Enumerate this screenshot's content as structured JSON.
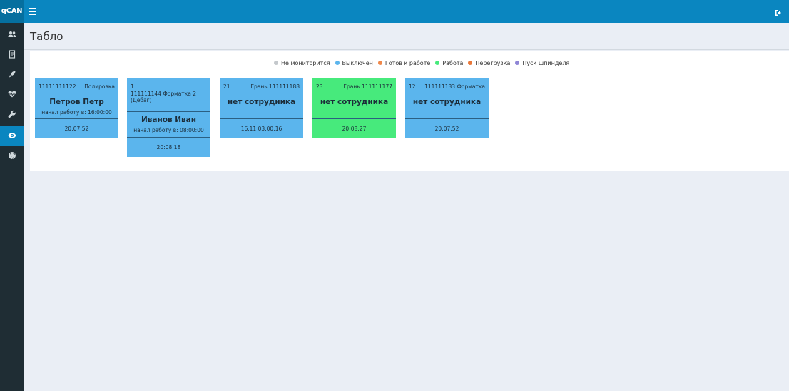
{
  "app": {
    "logo": "qCAN"
  },
  "header": {
    "menu_icon": "hamburger-icon",
    "logout_icon": "logout-icon"
  },
  "sidebar": {
    "items": [
      {
        "icon": "users-icon"
      },
      {
        "icon": "document-icon"
      },
      {
        "icon": "rocket-icon"
      },
      {
        "icon": "heart-pulse-icon"
      },
      {
        "icon": "wrench-icon"
      },
      {
        "icon": "eye-icon",
        "active": true
      },
      {
        "icon": "globe-icon"
      }
    ]
  },
  "page": {
    "title": "Табло"
  },
  "legend": [
    {
      "label": "Не мониторится",
      "color": "#c4c8cc"
    },
    {
      "label": "Выключен",
      "color": "#5bb5ed"
    },
    {
      "label": "Готов к работе",
      "color": "#f0884a"
    },
    {
      "label": "Работа",
      "color": "#47ea7c"
    },
    {
      "label": "Перегрузка",
      "color": "#e9783a"
    },
    {
      "label": "Пуск шпинделя",
      "color": "#8f86d6"
    }
  ],
  "cards": [
    {
      "left": "11111111122",
      "right": "Полировка",
      "name": "Петров Петр",
      "sub": "начал работу в: 16:00:00",
      "time": "20:07:52",
      "status": "Выключен"
    },
    {
      "line1": "1",
      "line2": "111111144 Форматка 2",
      "line3": "(Дебаг)",
      "name": "Иванов Иван",
      "sub": "начал работу в: 08:00:00",
      "time": "20:08:18",
      "status": "Выключен"
    },
    {
      "left": "21",
      "right": "Грань 111111188",
      "name": "нет сотрудника",
      "time": "16.11 03:00:16",
      "status": "Выключен"
    },
    {
      "left": "23",
      "right": "Грань 111111177",
      "name": "нет сотрудника",
      "time": "20:08:27",
      "status": "Работа"
    },
    {
      "left": "12",
      "right": "111111133 Форматка",
      "name": "нет сотрудника",
      "time": "20:07:52",
      "status": "Выключен"
    }
  ]
}
